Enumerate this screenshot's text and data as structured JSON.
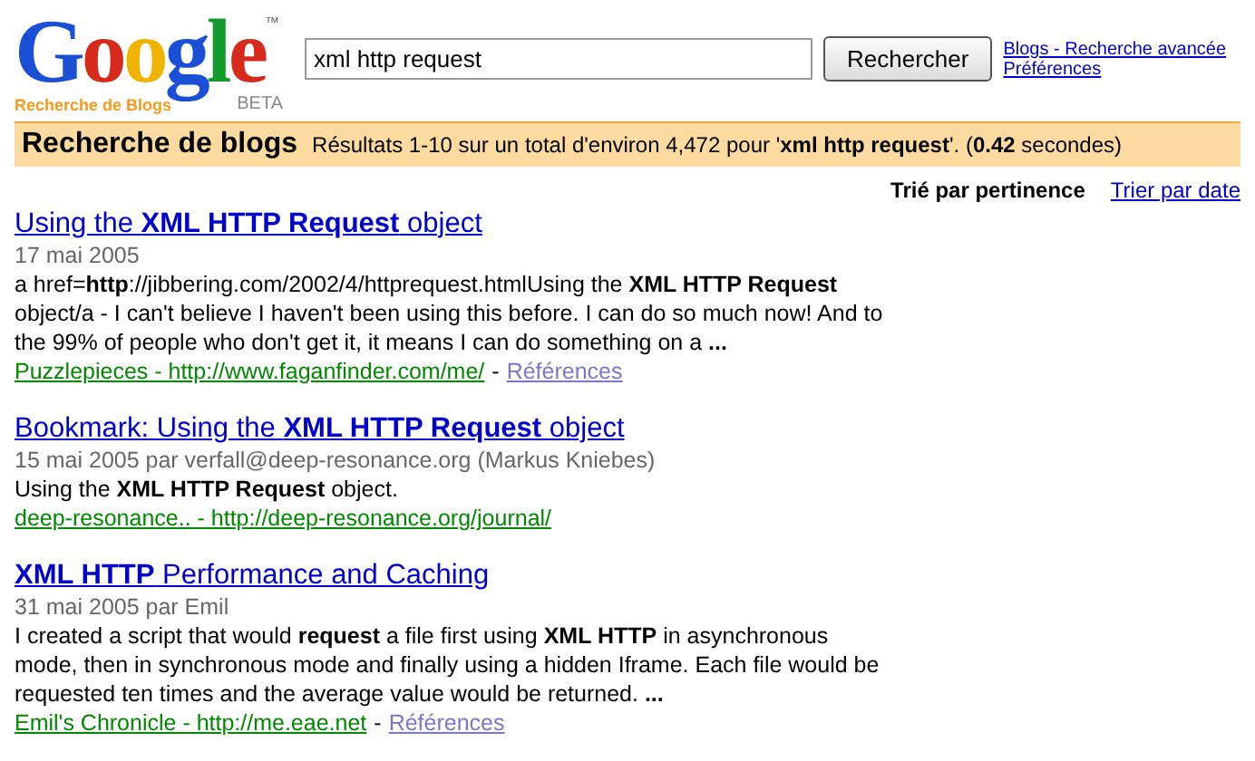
{
  "logo": {
    "wordmark": "Google",
    "trademark": "™",
    "subtitle": "Recherche de Blogs",
    "badge": "BETA"
  },
  "search": {
    "value": "xml http request",
    "button": "Rechercher"
  },
  "header_links": [
    "Blogs - Recherche avancée",
    "Préférences"
  ],
  "results_bar": {
    "title": "Recherche de blogs",
    "summary": "Résultats 1-10 sur un total d'environ 4,472 pour '**xml http request**'. (**0.42** secondes)"
  },
  "sort_options": [
    {
      "label": "Trié par pertinence",
      "selected": true
    },
    {
      "label": "Trier par date",
      "selected": false
    }
  ],
  "results": [
    {
      "title": "Using the **XML HTTP Request** object",
      "meta": "17 mai 2005",
      "snippet": "a href=**http**://jibbering.com/2002/4/httprequest.htmlUsing the **XML HTTP Request** object/a - I can't believe I haven't been using this before. I can do so much now! And to the 99% of people who don't get it, it means I can do something on a **...**",
      "source": "Puzzlepieces - http://www.faganfinder.com/me/",
      "separator": "-",
      "references": "Références"
    },
    {
      "title": "Bookmark: Using the **XML HTTP Request** object",
      "meta": "15 mai 2005 par verfall@deep-resonance.org (Markus Kniebes)",
      "snippet": "Using the **XML HTTP Request** object.",
      "source": "deep-resonance.. - http://deep-resonance.org/journal/"
    },
    {
      "title": "**XML HTTP** Performance and Caching",
      "meta": "31 mai 2005 par Emil",
      "snippet": "I created a script that would **request** a file first using **XML HTTP** in asynchronous mode, then in synchronous mode and finally using a hidden Iframe. Each file would be requested ten times and the average value would be returned. **...**",
      "source": "Emil's Chronicle - http://me.eae.net",
      "separator": "-",
      "references": "Références"
    }
  ]
}
